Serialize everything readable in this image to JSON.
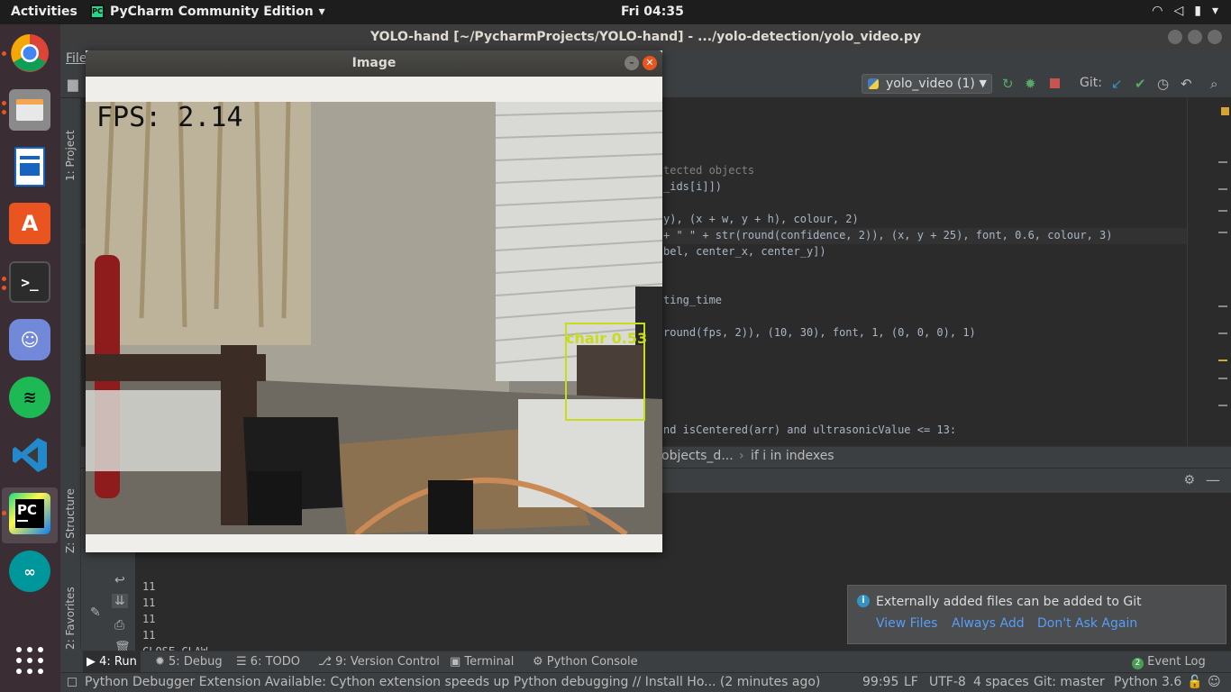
{
  "topbar": {
    "activities": "Activities",
    "app_name": "PyCharm Community Edition",
    "clock": "Fri 04:35"
  },
  "dock": {
    "apps": [
      "chrome-icon",
      "files-icon",
      "writer-icon",
      "software-icon",
      "terminal-icon",
      "discord-icon",
      "spotify-icon",
      "vscode-icon",
      "pycharm-icon",
      "arduino-icon",
      "show-apps-icon"
    ]
  },
  "window": {
    "title": "YOLO-hand [~/PycharmProjects/YOLO-hand] - .../yolo-detection/yolo_video.py",
    "menu_file": "File"
  },
  "toolbar": {
    "run_config": "yolo_video (1)",
    "git_label": "Git:"
  },
  "sidebar": {
    "project": "1: Project",
    "structure": "Z: Structure",
    "favorites": "2: Favorites"
  },
  "editor": {
    "lines": [
      {
        "t": "tected objects",
        "kind": "cmt"
      },
      {
        "t": "_ids[i]])",
        "kind": "code"
      },
      {
        "t": "",
        "kind": "code"
      },
      {
        "t": "y), (x + w, y + h), colour, 2)",
        "kind": "code"
      },
      {
        "t": "+ \" \" + str(round(confidence, 2)), (x, y + 25), font, 0.6, colour, 3)",
        "kind": "code"
      },
      {
        "t": "bel, center_x, center_y])",
        "kind": "code"
      },
      {
        "t": "",
        "kind": "code"
      },
      {
        "t": "",
        "kind": "code"
      },
      {
        "t": "ting_time",
        "kind": "code"
      },
      {
        "t": "",
        "kind": "code"
      },
      {
        "t": "round(fps, 2)), (10, 30), font, 1, (0, 0, 0), 1)",
        "kind": "code"
      },
      {
        "t": "",
        "kind": "code"
      },
      {
        "t": "",
        "kind": "code"
      },
      {
        "t": "",
        "kind": "code"
      },
      {
        "t": "",
        "kind": "code"
      },
      {
        "t": "nd isCentered(arr) and ultrasonicValue <= 13:",
        "kind": "code"
      }
    ]
  },
  "breadcrumb": {
    "part1": "objects_d...",
    "sep": "›",
    "part2": "if i in indexes"
  },
  "console": {
    "lines": [
      "11",
      "11",
      "11",
      "11",
      "CLOSE CLAW"
    ]
  },
  "notification": {
    "message": "Externally added files can be added to Git",
    "view_files": "View Files",
    "always_add": "Always Add",
    "dont_ask": "Don't Ask Again"
  },
  "tool_windows": {
    "run": "4: Run",
    "debug": "5: Debug",
    "todo": "6: TODO",
    "vcs": "9: Version Control",
    "terminal": "Terminal",
    "python_console": "Python Console",
    "event_log": "Event Log",
    "event_log_count": "2"
  },
  "statusbar": {
    "message": "Python Debugger Extension Available: Cython extension speeds up Python debugging // Install  Ho... (2 minutes ago)",
    "position": "99:95",
    "line_sep": "LF",
    "encoding": "UTF-8",
    "indent": "4 spaces",
    "git_branch": "Git: master",
    "interpreter": "Python 3.6"
  },
  "image_window": {
    "title": "Image",
    "fps_text": "FPS: 2.14",
    "detection_label": "chair 0.53"
  },
  "colors": {
    "detection": "#c8dc1e",
    "accent_link": "#589df6"
  }
}
